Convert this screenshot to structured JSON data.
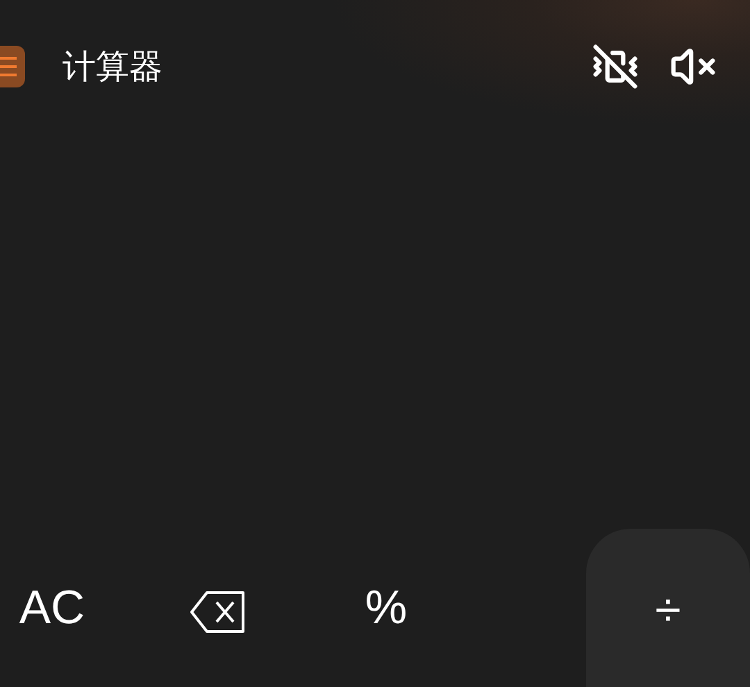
{
  "header": {
    "title": "计算器"
  },
  "keys": [
    {
      "kind": "text",
      "label": "AC"
    },
    {
      "kind": "backspace"
    },
    {
      "kind": "text",
      "label": "%"
    },
    {
      "kind": "operator",
      "label": "÷"
    }
  ]
}
